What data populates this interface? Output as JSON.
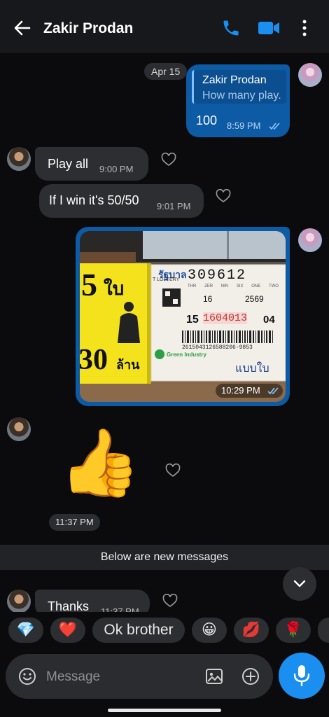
{
  "header": {
    "contact_name": "Zakir Prodan",
    "icons": [
      "back-arrow-icon",
      "phone-icon",
      "video-camera-icon",
      "more-vertical-icon"
    ],
    "accent_color": "#1a8ff0"
  },
  "date_divider": "Apr 15",
  "messages": {
    "m1": {
      "reply_to_name": "Zakir Prodan",
      "reply_to_text": "How many play.",
      "text": "100",
      "time": "8:59 PM",
      "status": "read"
    },
    "m2": {
      "text": "Play all",
      "time": "9:00 PM"
    },
    "m3": {
      "text": "If I win it's 50/50",
      "time": "9:01 PM"
    },
    "m4": {
      "time": "10:29 PM",
      "status": "read",
      "photo_text": {
        "big_number": "5",
        "thai_unit": "ใบ",
        "bottom_number": "30",
        "bottom_thai": "ล้าน",
        "lottery_brand": "รัฐบาล",
        "lottery_sub": "T LOTTERY",
        "ticket_number": "309612",
        "digit_labels": [
          "THR",
          "ZER",
          "NIN",
          "SIX",
          "ONE",
          "TWO"
        ],
        "draw_day": "16",
        "year": "2569",
        "set_number": "15",
        "serial": "1604013",
        "serial_suffix": "04",
        "barcode_digits": "2615043126588206-9853",
        "maker": "Green Industry",
        "thai_label": "แบบใบ"
      }
    },
    "m5": {
      "emoji": "👍",
      "time": "11:37 PM"
    },
    "m6": {
      "text": "Thanks",
      "time": "11:37 PM"
    }
  },
  "new_messages_banner": "Below are new messages",
  "quick_replies": [
    {
      "label": "💎"
    },
    {
      "label": "❤️"
    },
    {
      "label": "Ok brother"
    },
    {
      "label": "😀"
    },
    {
      "label": "💋"
    },
    {
      "label": "🌹"
    }
  ],
  "composer": {
    "placeholder": "Message"
  }
}
